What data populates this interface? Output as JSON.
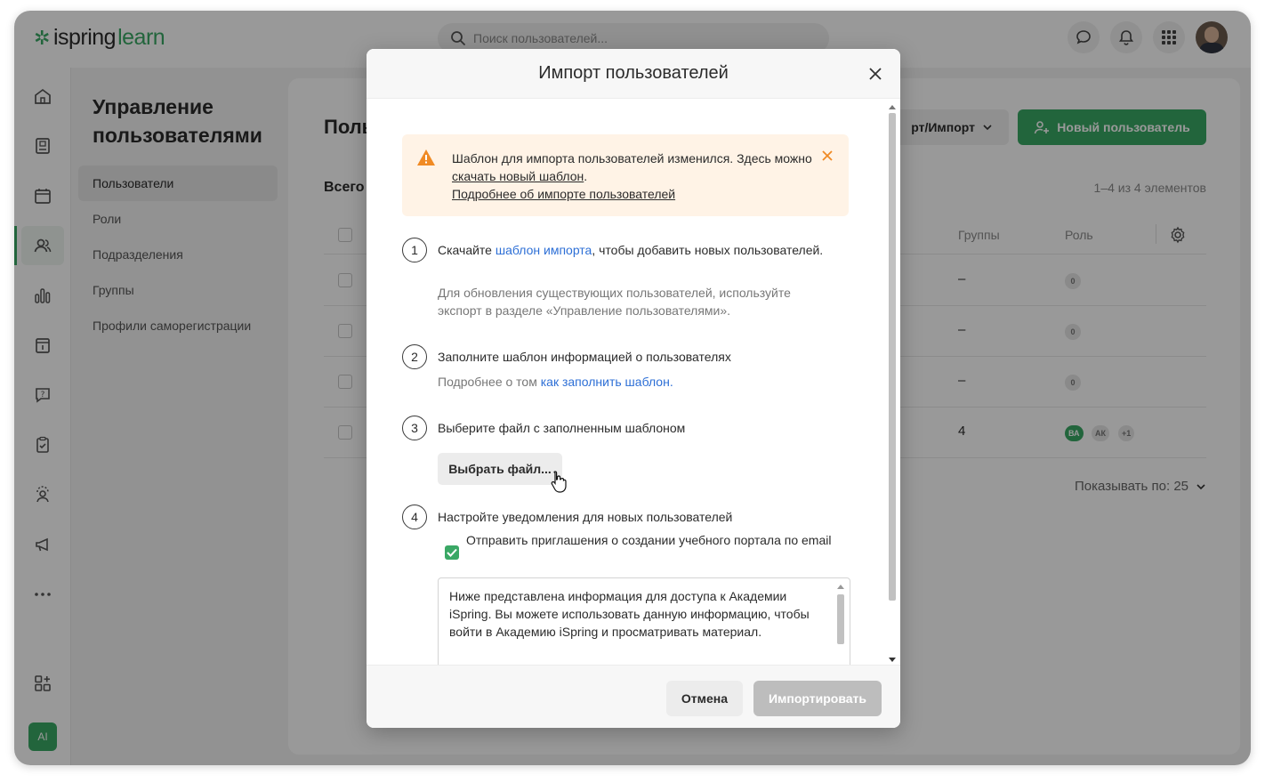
{
  "app": {
    "logo_word1": "ispring",
    "logo_word2": "learn",
    "brand_color": "#3aa865"
  },
  "search": {
    "placeholder": "Поиск пользователей..."
  },
  "subnav": {
    "title": "Управление пользователями",
    "items": [
      {
        "label": "Пользователи"
      },
      {
        "label": "Роли"
      },
      {
        "label": "Подразделения"
      },
      {
        "label": "Группы"
      },
      {
        "label": "Профили саморегистрации"
      }
    ]
  },
  "main": {
    "title_partial": "Поль",
    "total_partial": "Всего",
    "export_label": "рт/Импорт",
    "new_user_label": "Новый пользователь",
    "range": "1–4 из 4 элементов",
    "columns": {
      "groups": "Группы",
      "role": "Роль"
    },
    "rows": [
      {
        "groups": "–",
        "roles": [
          "0"
        ]
      },
      {
        "groups": "–",
        "roles": [
          "0"
        ]
      },
      {
        "groups": "–",
        "roles": [
          "0"
        ]
      },
      {
        "groups": "4",
        "roles": [
          "ВА",
          "АК",
          "+1"
        ]
      }
    ],
    "per_page": "Показывать по: 25"
  },
  "modal": {
    "title": "Импорт пользователей",
    "alert": {
      "text1": "Шаблон для импорта пользователей изменился. Здесь можно ",
      "link1": "скачать новый шаблон",
      "text2": ".",
      "link2": "Подробнее об импорте пользователей"
    },
    "step1": {
      "num": "1",
      "text_before": "Скачайте ",
      "link": "шаблон импорта",
      "text_after": ", чтобы добавить новых пользователей.",
      "sub": "Для обновления существующих пользователей, используйте экспорт в разделе «Управление пользователями»."
    },
    "step2": {
      "num": "2",
      "text": "Заполните шаблон информацией о пользователях",
      "sub_before": "Подробнее о том ",
      "sub_link": "как заполнить шаблон",
      "sub_after": "."
    },
    "step3": {
      "num": "3",
      "text": "Выберите файл с заполненным шаблоном",
      "button": "Выбрать файл..."
    },
    "step4": {
      "num": "4",
      "text": "Настройте уведомления для новых пользователей",
      "checkbox_label": "Отправить приглашения о создании учебного портала по email",
      "checked": true,
      "message": "Ниже представлена информация для доступа к Академии iSpring. Вы можете использовать данную информацию, чтобы войти в Академию iSpring и просматривать материал."
    },
    "cancel": "Отмена",
    "import": "Импортировать"
  },
  "user": {
    "ai_badge": "AI"
  }
}
